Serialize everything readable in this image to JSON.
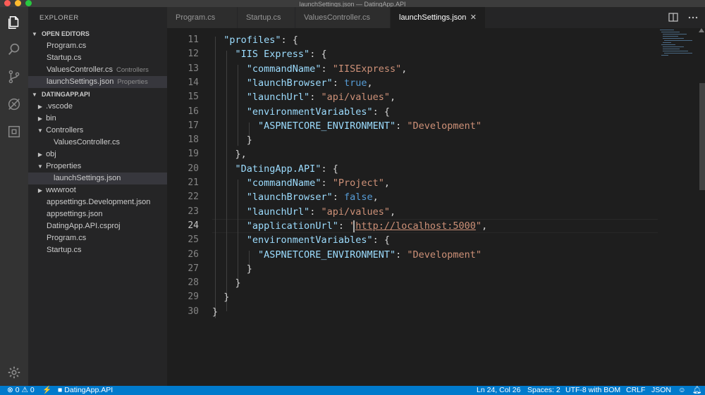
{
  "window": {
    "title": "launchSettings.json — DatingApp.API"
  },
  "sidebar": {
    "title": "EXPLORER",
    "open_editors_label": "OPEN EDITORS",
    "open_editors": [
      {
        "name": "Program.cs",
        "desc": ""
      },
      {
        "name": "Startup.cs",
        "desc": ""
      },
      {
        "name": "ValuesController.cs",
        "desc": "Controllers"
      },
      {
        "name": "launchSettings.json",
        "desc": "Properties"
      }
    ],
    "project_label": "DATINGAPP.API",
    "tree": [
      {
        "name": ".vscode"
      },
      {
        "name": "bin"
      },
      {
        "name": "Controllers"
      },
      {
        "name": "ValuesController.cs"
      },
      {
        "name": "obj"
      },
      {
        "name": "Properties"
      },
      {
        "name": "launchSettings.json"
      },
      {
        "name": "wwwroot"
      },
      {
        "name": "appsettings.Development.json"
      },
      {
        "name": "appsettings.json"
      },
      {
        "name": "DatingApp.API.csproj"
      },
      {
        "name": "Program.cs"
      },
      {
        "name": "Startup.cs"
      }
    ]
  },
  "tabs": [
    {
      "label": "Program.cs"
    },
    {
      "label": "Startup.cs"
    },
    {
      "label": "ValuesController.cs"
    },
    {
      "label": "launchSettings.json",
      "close": "✕"
    }
  ],
  "editor": {
    "lines": [
      {
        "n": "11",
        "t": [
          [
            "p",
            "  "
          ],
          [
            "k",
            "\"profiles\""
          ],
          [
            "p",
            ": {"
          ]
        ]
      },
      {
        "n": "12",
        "t": [
          [
            "p",
            "    "
          ],
          [
            "k",
            "\"IIS Express\""
          ],
          [
            "p",
            ": {"
          ]
        ]
      },
      {
        "n": "13",
        "t": [
          [
            "p",
            "      "
          ],
          [
            "k",
            "\"commandName\""
          ],
          [
            "p",
            ": "
          ],
          [
            "s",
            "\"IISExpress\""
          ],
          [
            "p",
            ","
          ]
        ]
      },
      {
        "n": "14",
        "t": [
          [
            "p",
            "      "
          ],
          [
            "k",
            "\"launchBrowser\""
          ],
          [
            "p",
            ": "
          ],
          [
            "b",
            "true"
          ],
          [
            "p",
            ","
          ]
        ]
      },
      {
        "n": "15",
        "t": [
          [
            "p",
            "      "
          ],
          [
            "k",
            "\"launchUrl\""
          ],
          [
            "p",
            ": "
          ],
          [
            "s",
            "\"api/values\""
          ],
          [
            "p",
            ","
          ]
        ]
      },
      {
        "n": "16",
        "t": [
          [
            "p",
            "      "
          ],
          [
            "k",
            "\"environmentVariables\""
          ],
          [
            "p",
            ": {"
          ]
        ]
      },
      {
        "n": "17",
        "t": [
          [
            "p",
            "        "
          ],
          [
            "k",
            "\"ASPNETCORE_ENVIRONMENT\""
          ],
          [
            "p",
            ": "
          ],
          [
            "s",
            "\"Development\""
          ]
        ]
      },
      {
        "n": "18",
        "t": [
          [
            "p",
            "      }"
          ]
        ]
      },
      {
        "n": "19",
        "t": [
          [
            "p",
            "    },"
          ]
        ]
      },
      {
        "n": "20",
        "t": [
          [
            "p",
            "    "
          ],
          [
            "k",
            "\"DatingApp.API\""
          ],
          [
            "p",
            ": {"
          ]
        ]
      },
      {
        "n": "21",
        "t": [
          [
            "p",
            "      "
          ],
          [
            "k",
            "\"commandName\""
          ],
          [
            "p",
            ": "
          ],
          [
            "s",
            "\"Project\""
          ],
          [
            "p",
            ","
          ]
        ]
      },
      {
        "n": "22",
        "t": [
          [
            "p",
            "      "
          ],
          [
            "k",
            "\"launchBrowser\""
          ],
          [
            "p",
            ": "
          ],
          [
            "b",
            "false"
          ],
          [
            "p",
            ","
          ]
        ]
      },
      {
        "n": "23",
        "t": [
          [
            "p",
            "      "
          ],
          [
            "k",
            "\"launchUrl\""
          ],
          [
            "p",
            ": "
          ],
          [
            "s",
            "\"api/values\""
          ],
          [
            "p",
            ","
          ]
        ]
      },
      {
        "n": "24",
        "t": [
          [
            "p",
            "      "
          ],
          [
            "k",
            "\"applicationUrl\""
          ],
          [
            "p",
            ": "
          ],
          [
            "s",
            "\""
          ],
          [
            "u",
            "http://localhost:5000"
          ],
          [
            "s",
            "\""
          ],
          [
            "p",
            ","
          ]
        ]
      },
      {
        "n": "25",
        "t": [
          [
            "p",
            "      "
          ],
          [
            "k",
            "\"environmentVariables\""
          ],
          [
            "p",
            ": {"
          ]
        ]
      },
      {
        "n": "26",
        "t": [
          [
            "p",
            "        "
          ],
          [
            "k",
            "\"ASPNETCORE_ENVIRONMENT\""
          ],
          [
            "p",
            ": "
          ],
          [
            "s",
            "\"Development\""
          ]
        ]
      },
      {
        "n": "27",
        "t": [
          [
            "p",
            "      }"
          ]
        ]
      },
      {
        "n": "28",
        "t": [
          [
            "p",
            "    }"
          ]
        ]
      },
      {
        "n": "29",
        "t": [
          [
            "p",
            "  }"
          ]
        ]
      },
      {
        "n": "30",
        "t": [
          [
            "p",
            "}"
          ]
        ]
      }
    ],
    "current_line": "24"
  },
  "statusbar": {
    "errors": "0",
    "warnings": "0",
    "folder": "DatingApp.API",
    "position": "Ln 24, Col 26",
    "spaces": "Spaces: 2",
    "encoding": "UTF-8 with BOM",
    "eol": "CRLF",
    "language": "JSON"
  },
  "colors": {
    "accent": "#007acc",
    "string": "#ce9178",
    "key": "#9cdcfe",
    "keyword": "#569cd6"
  }
}
